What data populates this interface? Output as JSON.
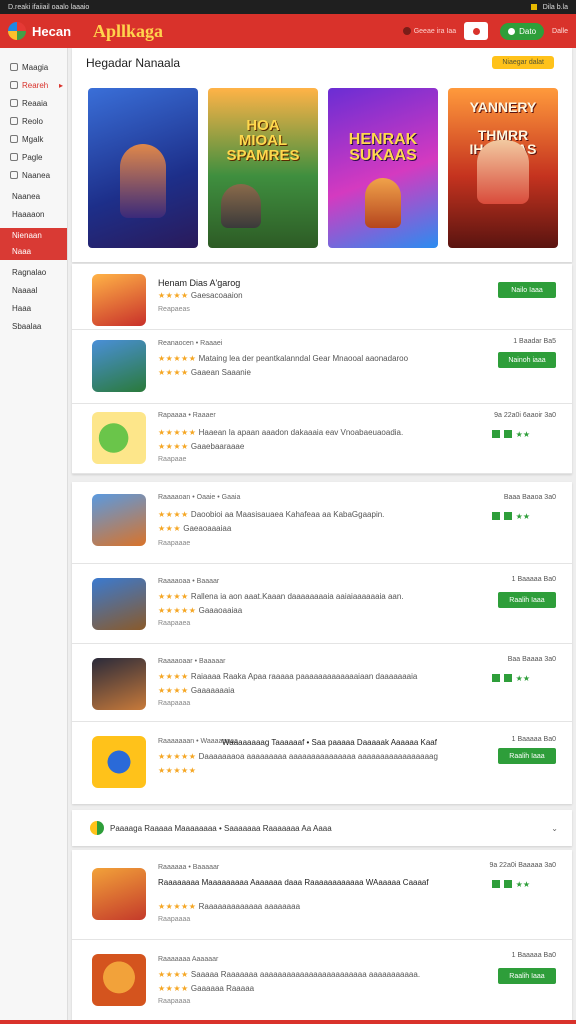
{
  "status": {
    "left": "D.reaki ifaiiail oaalo laaaio",
    "right": "Dila  b.la"
  },
  "header": {
    "brand": "Hecan",
    "title": "Apllkaga",
    "link": "Geeae ira Iaa",
    "button": "Dato",
    "end": "Dalle"
  },
  "sidebar": {
    "items": [
      {
        "label": "Maagia",
        "icon": "home-icon"
      },
      {
        "label": "Reareh",
        "icon": "apps-icon",
        "active": true
      },
      {
        "label": "Reaaia",
        "icon": "grid-icon"
      },
      {
        "label": "Reolo",
        "icon": "store-icon"
      },
      {
        "label": "Mgalk",
        "icon": "user-icon"
      },
      {
        "label": "Pagle",
        "icon": "list-icon"
      },
      {
        "label": "Naanea",
        "icon": "settings-icon"
      }
    ],
    "plain": [
      "Naanea",
      "Haaaaon"
    ],
    "highlight": [
      "Nienaan",
      "Naaa"
    ],
    "more": [
      "Ragnalao",
      "Naaaal",
      "Haaa",
      "Sbaalaa"
    ]
  },
  "featured": {
    "title": "Hegadar Nanaala",
    "see_all": "Niaegar dalat",
    "banners": [
      {
        "caption": ""
      },
      {
        "caption": "HOA\nMIOAL\nSPAMRES"
      },
      {
        "caption": "HENRAK\nSUKAAS"
      },
      {
        "caption": "YANNERY\n\nTHMRR\nIHAKEIAS"
      }
    ]
  },
  "apps": [
    {
      "meta": "",
      "name": "Henam Dias A'garog",
      "stars": "★★★★",
      "stars_text": "Gaesacoaaion",
      "dev": "Reapaeas",
      "right": "",
      "button": "Nailo Iaaa"
    },
    {
      "meta": "Reanaocen • Raaaei",
      "name": "Mataing lea der peantkalanndal Gear Mnaooal aaonadaroo",
      "stars": "★★★★",
      "stars_text": "Gaaean Saaanie",
      "dev": "",
      "right": "1 Baadar  Ba5",
      "button": "Nainoh iaaa"
    },
    {
      "meta": "Rapaaaa • Raaaer",
      "name": "Haaean la apaan aaadon dakaaaia eav Vnoabaeuaoadia.",
      "stars": "★★★★★",
      "stars_text": "Gaaebaaraaae",
      "dev": "Raapaae",
      "right": "9a  22a0i 6aaoir  3a0",
      "button": ""
    },
    {
      "meta": "Raaaaoan • Oaaie • Gaaia",
      "name": "Daoobioi aa Maasisauaea Kahafeaa aa KabaGgaapin.",
      "stars": "★★★★",
      "stars_text": "Gaeaoaaaiaa",
      "dev": "Raapaaae",
      "right": "Baaa Baaoa  3a0",
      "button": ""
    },
    {
      "meta": "Raaaaoaa • Baaaar",
      "name": "Rallena ia aon aaat.Kaaan daaaaaaaaia aaiaiaaaaaaia aan.",
      "stars": "★★★★",
      "stars_text": "Gaaaoaaiaa",
      "dev": "Raapaaea",
      "right": "1 Baaaaa  Ba0",
      "button": "Raalih Iaaa"
    },
    {
      "meta": "Raaaaoaar • Baaaaar",
      "name": "Raiaaaa Raaka Apaa raaaaa paaaaaaaaaaaaaiaan daaaaaaaia",
      "stars": "★★★★",
      "stars_text": "Gaaaaaaaia",
      "dev": "Raapaaaa",
      "right": "Baa Baaaa  3a0",
      "button": ""
    },
    {
      "meta": "Raaaaaaan • Waaaaaaaa",
      "name": "Waaaaaaaag Taaaaaaf • Saa paaaaa Daaaaak Aaaaaa Kaaf",
      "stars": "★★★★★",
      "stars_text": "Daaaaaaaoa aaaaaaaaa aaaaaaaaaaaaaaa aaaaaaaaaaaaaaaaag",
      "dev": "",
      "right": "1 Baaaaa  Ba0",
      "button": "Raalih Iaaa"
    }
  ],
  "section": {
    "label": "Paaaaga Raaaaa Maaaaaaaa • Saaaaaaa Raaaaaaa Aa Aaaa"
  },
  "apps2": [
    {
      "meta": "Raaaaaa • Baaaaar",
      "name": "Raaaaaaaa Maaaaaaaaa Aaaaaaa daaa Raaaaaaaaaaaa WAaaaaa Caaaaf",
      "stars": "★★★★★",
      "stars_text": "Raaaaaaaaaaaaa aaaaaaaa",
      "dev": "Raapaaaa",
      "right": "9a  22a0i Baaaaa  3a0",
      "button": ""
    },
    {
      "meta": "Raaaaaaa Aaaaaar",
      "name": "Saaaaa Raaaaaaa aaaaaaaaaaaaaaaaaaaaaaaa aaaaaaaaaaa.",
      "stars": "★★★★",
      "stars_text": "Gaaaaaa Raaaaa",
      "dev": "Raapaaaa",
      "right": "1 Baaaaa  Ba0",
      "button": "Raalih Iaaa"
    }
  ],
  "colors": {
    "accent": "#d9322b",
    "install": "#2e9e3a",
    "star": "#f5a623",
    "see_all": "#ffc21a"
  }
}
